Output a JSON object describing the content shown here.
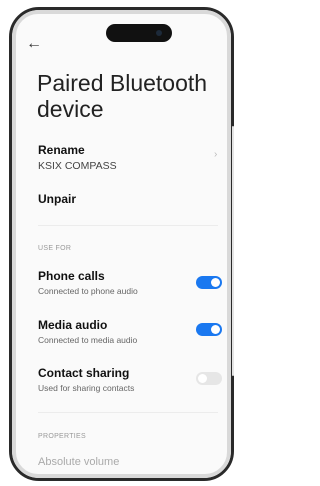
{
  "header": {
    "back_icon": "←",
    "title": "Paired Bluetooth device"
  },
  "rename": {
    "label": "Rename",
    "value": "KSIX COMPASS"
  },
  "unpair": {
    "label": "Unpair"
  },
  "use_for": {
    "section_label": "USE FOR",
    "items": [
      {
        "label": "Phone calls",
        "sub": "Connected to phone audio",
        "enabled": true
      },
      {
        "label": "Media audio",
        "sub": "Connected to media audio",
        "enabled": true
      },
      {
        "label": "Contact sharing",
        "sub": "Used for sharing contacts",
        "enabled": false
      }
    ]
  },
  "properties": {
    "section_label": "PROPERTIES",
    "first_item": "Absolute volume"
  },
  "colors": {
    "toggle_on": "#1a78f0",
    "toggle_off": "#e6e6e6"
  }
}
